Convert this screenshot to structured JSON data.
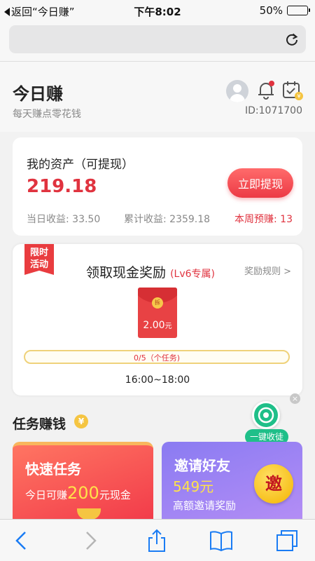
{
  "status_bar": {
    "back_label": "返回“今日赚”",
    "time": "下午8:02",
    "battery": "50%",
    "battery_level": 0.5
  },
  "header": {
    "title": "今日赚",
    "subtitle": "每天赚点零花钱",
    "user_id": "ID:1071700"
  },
  "assets": {
    "title": "我的资产（可提现）",
    "amount": "219.18",
    "withdraw_label": "立即提现",
    "today_income": "当日收益: 33.50",
    "total_income": "累计收益: 2359.18",
    "week_estimate": "本周预赚: 13"
  },
  "reward": {
    "badge_line1": "限时",
    "badge_line2": "活动",
    "title": "领取现金奖励",
    "level": "(Lv6专属)",
    "rules_link": "奖励规则 >",
    "packet_coin": "拆",
    "packet_amount": "2.00",
    "packet_unit": "元",
    "progress_text": "0/5（个任务)",
    "progress_fraction": 0,
    "time_window": "16:00~18:00"
  },
  "tasks": {
    "section_title": "任务赚钱",
    "yen_symbol": "¥",
    "collect_label": "一键收徒",
    "close_symbol": "×",
    "quick": {
      "name": "快速任务",
      "desc_prefix": "今日可赚",
      "desc_amount": "200",
      "desc_suffix": "元现金"
    },
    "invite": {
      "name": "邀请好友",
      "amount": "549元",
      "desc": "高额邀请奖励",
      "badge": "邀"
    }
  },
  "colors": {
    "accent_red": "#e0333f",
    "button_red": "#ec3a45",
    "gold": "#f5c542",
    "green": "#1fbf89",
    "purple": "#8a7bf2"
  },
  "icons": {
    "reload": "reload-icon",
    "bell": "bell-icon",
    "calendar": "calendar-check-icon",
    "back": "back-arrow-icon",
    "forward": "forward-arrow-icon",
    "share": "share-icon",
    "bookmarks": "bookmarks-icon",
    "tabs": "tabs-icon"
  }
}
